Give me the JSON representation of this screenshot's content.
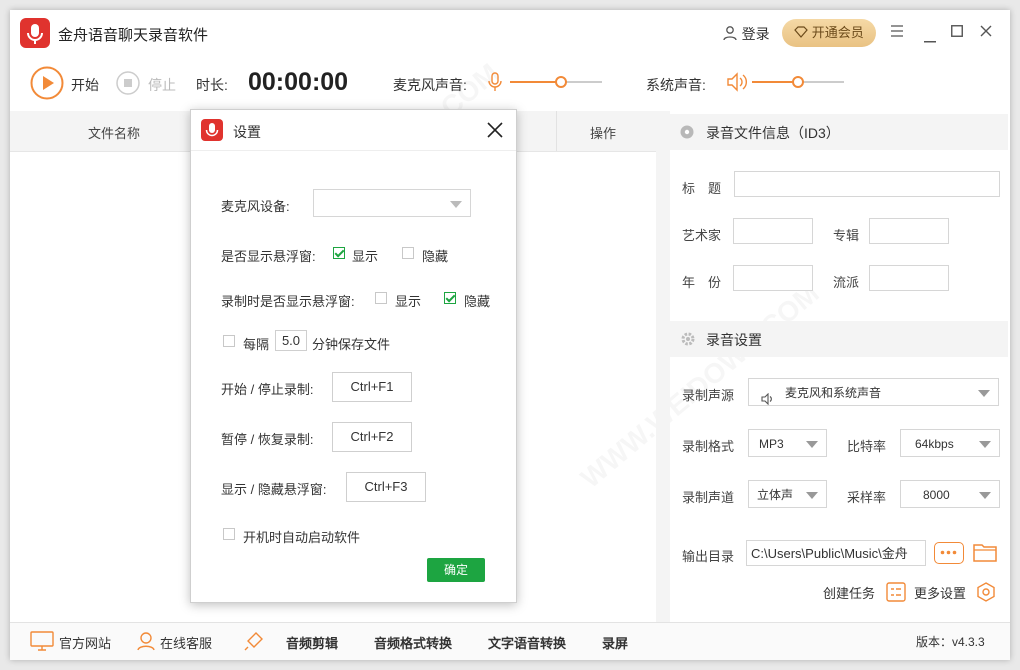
{
  "app": {
    "title": "金舟语音聊天录音软件",
    "login": "登录",
    "vip": "开通会员"
  },
  "toolbar": {
    "start": "开始",
    "stop": "停止",
    "duration_label": "时长:",
    "duration": "00:00:00",
    "mic_label": "麦克风声音:",
    "sys_label": "系统声音:",
    "mic_level": 0.55,
    "sys_level": 0.5
  },
  "table": {
    "col_name": "文件名称",
    "col_ops": "操作"
  },
  "id3": {
    "heading": "录音文件信息（ID3）",
    "title_label": "标　题",
    "artist_label": "艺术家",
    "album_label": "专辑",
    "year_label": "年　份",
    "genre_label": "流派"
  },
  "rec": {
    "heading": "录音设置",
    "source_label": "录制声源",
    "source_value": "麦克风和系统声音",
    "format_label": "录制格式",
    "format_value": "MP3",
    "bitrate_label": "比特率",
    "bitrate_value": "64kbps",
    "channel_label": "录制声道",
    "channel_value": "立体声",
    "samplerate_label": "采样率",
    "samplerate_value": "8000",
    "output_label": "输出目录",
    "output_value": "C:\\Users\\Public\\Music\\金舟",
    "create_task": "创建任务",
    "more_settings": "更多设置"
  },
  "footer": {
    "website": "官方网站",
    "service": "在线客服",
    "audio_edit": "音频剪辑",
    "format_convert": "音频格式转换",
    "tts": "文字语音转换",
    "screen_rec": "录屏",
    "version": "版本：v4.3.3"
  },
  "dialog": {
    "title": "设置",
    "mic_device_label": "麦克风设备:",
    "float_label": "是否显示悬浮窗:",
    "show": "显示",
    "hide": "隐藏",
    "float_rec_label": "录制时是否显示悬浮窗:",
    "autosave_prefix": "每隔",
    "autosave_value": "5.0",
    "autosave_suffix": "分钟保存文件",
    "hk1_label": "开始 / 停止录制:",
    "hk1": "Ctrl+F1",
    "hk2_label": "暂停 / 恢复录制:",
    "hk2": "Ctrl+F2",
    "hk3_label": "显示 / 隐藏悬浮窗:",
    "hk3": "Ctrl+F3",
    "autostart_label": "开机时自动启动软件",
    "ok": "确定"
  },
  "watermark": "WWW.WEIDOWN.COM",
  "colors": {
    "accent": "#f28a38",
    "brand_red": "#e0332e",
    "ok_green": "#1da541",
    "vip_gold": "#e9c283"
  }
}
